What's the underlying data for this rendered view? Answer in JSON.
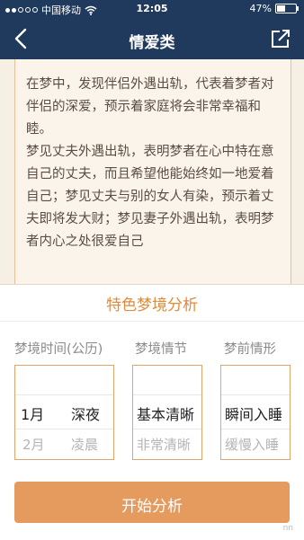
{
  "status_bar": {
    "carrier": "中国移动",
    "time": "12:05",
    "battery": "47%",
    "battery_level": 0.47,
    "signal_icon": "signal-dots-icon",
    "wifi_icon": "wifi-icon",
    "battery_icon": "battery-icon"
  },
  "nav": {
    "title": "情爱类",
    "back_icon": "back-arrow-icon",
    "share_icon": "share-icon"
  },
  "article": {
    "paragraphs": [
      "在梦中，发现伴侣外遇出轨，代表着梦者对伴侣的深爱，预示着家庭将会非常幸福和睦。",
      "梦见丈夫外遇出轨，表明梦者在心中特在意自己的丈夫，而且希望他能始终如一地爱着自己；梦见丈夫与别的女人有染，预示着丈夫即将发大财；梦见妻子外遇出轨，表明梦者内心之处很爱自己"
    ]
  },
  "panel": {
    "title": "特色梦境分析",
    "columns": [
      {
        "label": "梦境时间(公历)",
        "selected_a": "1月",
        "selected_b": "深夜",
        "next_a": "2月",
        "next_b": "凌晨"
      },
      {
        "label": "梦境情节",
        "selected": "基本清晰",
        "next": "非常清晰"
      },
      {
        "label": "梦前情形",
        "selected": "瞬间入睡",
        "next": "缓慢入睡"
      }
    ],
    "button": "开始分析"
  },
  "watermark": "nn",
  "colors": {
    "nav_bg": "#1f3a5d",
    "accent": "#e08a3c",
    "button_bg": "#e59a5e",
    "article_bg": "#fbf4ea",
    "border": "#e8bf98"
  }
}
